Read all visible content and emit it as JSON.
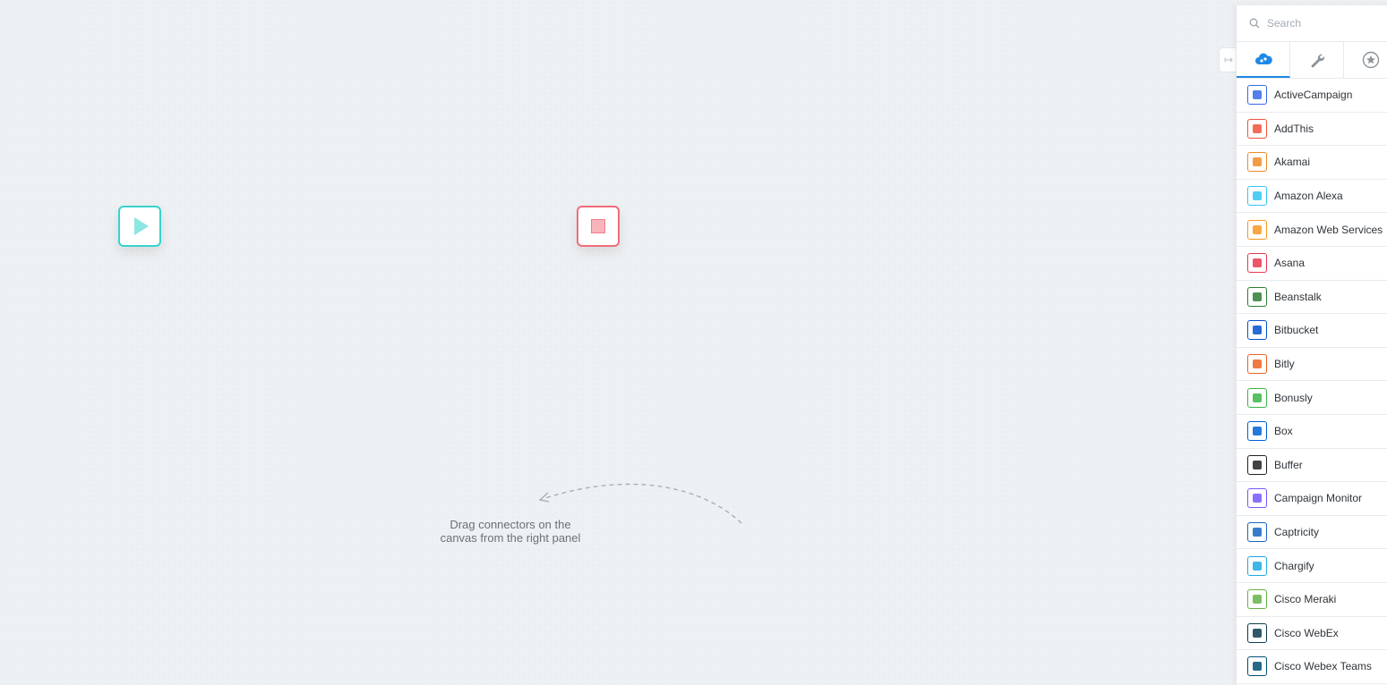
{
  "canvas": {
    "hint": {
      "line1": "Drag connectors on the",
      "line2": "canvas from the right panel"
    },
    "colors": {
      "start": "#38d3cd",
      "stop": "#f16c7a"
    }
  },
  "panel": {
    "search": {
      "placeholder": "Search",
      "value": ""
    },
    "tabs": [
      {
        "icon": "cloud-connectors-icon",
        "active": true
      },
      {
        "icon": "wrench-icon",
        "active": false
      },
      {
        "icon": "star-icon",
        "active": false
      }
    ],
    "accent": "#1e88e5",
    "connectors": [
      {
        "label": "ActiveCampaign",
        "icon": "activecampaign-logo-icon",
        "color": "#3569e8"
      },
      {
        "label": "AddThis",
        "icon": "addthis-logo-icon",
        "color": "#f0533b"
      },
      {
        "label": "Akamai",
        "icon": "akamai-logo-icon",
        "color": "#f08a24"
      },
      {
        "label": "Amazon Alexa",
        "icon": "amazon-alexa-logo-icon",
        "color": "#31c4f3"
      },
      {
        "label": "Amazon Web Services",
        "icon": "aws-logo-icon",
        "color": "#f7971e"
      },
      {
        "label": "Asana",
        "icon": "asana-logo-icon",
        "color": "#e8384f"
      },
      {
        "label": "Beanstalk",
        "icon": "beanstalk-logo-icon",
        "color": "#2e7d32"
      },
      {
        "label": "Bitbucket",
        "icon": "bitbucket-logo-icon",
        "color": "#0052cc"
      },
      {
        "label": "Bitly",
        "icon": "bitly-logo-icon",
        "color": "#ee6123"
      },
      {
        "label": "Bonusly",
        "icon": "bonusly-logo-icon",
        "color": "#3bb54a"
      },
      {
        "label": "Box",
        "icon": "box-logo-icon",
        "color": "#0061d5"
      },
      {
        "label": "Buffer",
        "icon": "buffer-logo-icon",
        "color": "#222222"
      },
      {
        "label": "Campaign Monitor",
        "icon": "campaign-monitor-logo-icon",
        "color": "#7856ff"
      },
      {
        "label": "Captricity",
        "icon": "captricity-logo-icon",
        "color": "#1565c0"
      },
      {
        "label": "Chargify",
        "icon": "chargify-logo-icon",
        "color": "#1fa9e1"
      },
      {
        "label": "Cisco Meraki",
        "icon": "cisco-meraki-logo-icon",
        "color": "#67b346"
      },
      {
        "label": "Cisco WebEx",
        "icon": "cisco-webex-logo-icon",
        "color": "#0d3b4f"
      },
      {
        "label": "Cisco Webex Teams",
        "icon": "cisco-webex-teams-logo-icon",
        "color": "#005073"
      }
    ]
  }
}
